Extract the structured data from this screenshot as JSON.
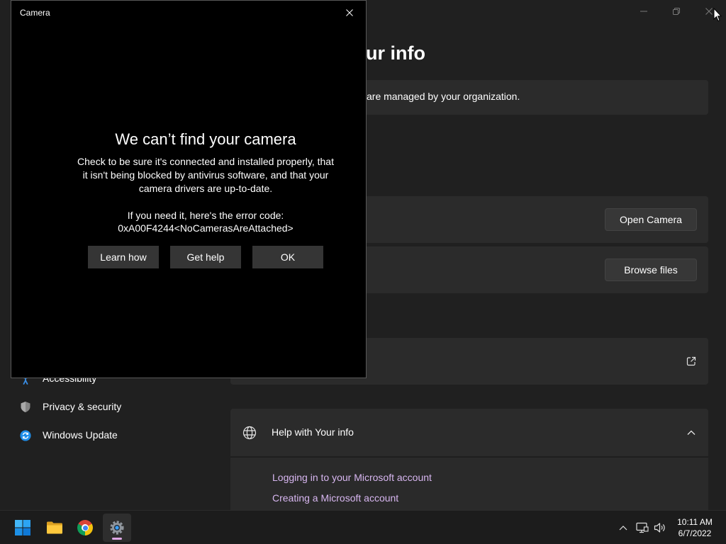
{
  "window": {
    "controls": [
      "minimize-icon",
      "restore-icon",
      "close-icon"
    ]
  },
  "settings": {
    "page_heading": "ur info",
    "org_notice": "are managed by your organization.",
    "open_camera_label": "Open Camera",
    "browse_files_label": "Browse files",
    "external_link_icon": "external-link-icon",
    "help": {
      "icon": "globe-icon",
      "title": "Help with Your info",
      "expanded": true,
      "links": [
        "Logging in to your Microsoft account",
        "Creating a Microsoft account"
      ]
    }
  },
  "sidebar": {
    "items": [
      {
        "label": "Accessibility",
        "icon": "accessibility-icon"
      },
      {
        "label": "Privacy & security",
        "icon": "shield-icon"
      },
      {
        "label": "Windows Update",
        "icon": "windows-update-icon"
      }
    ]
  },
  "dialog": {
    "title": "Camera",
    "heading": "We can’t find your camera",
    "body_lines": [
      "Check to be sure it's connected and installed properly, that",
      "it isn't being blocked by antivirus software, and that your",
      "camera drivers are up-to-date."
    ],
    "error_intro": "If you need it, here's the error code:",
    "error_code": "0xA00F4244<NoCamerasAreAttached>",
    "buttons": {
      "learn_how": "Learn how",
      "get_help": "Get help",
      "ok": "OK"
    }
  },
  "taskbar": {
    "apps": [
      {
        "icon": "start-icon"
      },
      {
        "icon": "file-explorer-icon"
      },
      {
        "icon": "chrome-icon"
      },
      {
        "icon": "settings-icon",
        "active": true
      }
    ],
    "tray_icons": [
      "chevron-up-icon",
      "network-icon",
      "volume-icon"
    ],
    "time": "10:11 AM",
    "date": "6/7/2022"
  },
  "colors": {
    "window_bg": "#202020",
    "card_bg": "#2b2b2b",
    "button_bg": "#373737",
    "dialog_bg": "#000000",
    "dialog_button_bg": "#353535",
    "link": "#d7b6f0",
    "taskbar_indicator": "#dfa7e6",
    "text": "#ffffff"
  }
}
